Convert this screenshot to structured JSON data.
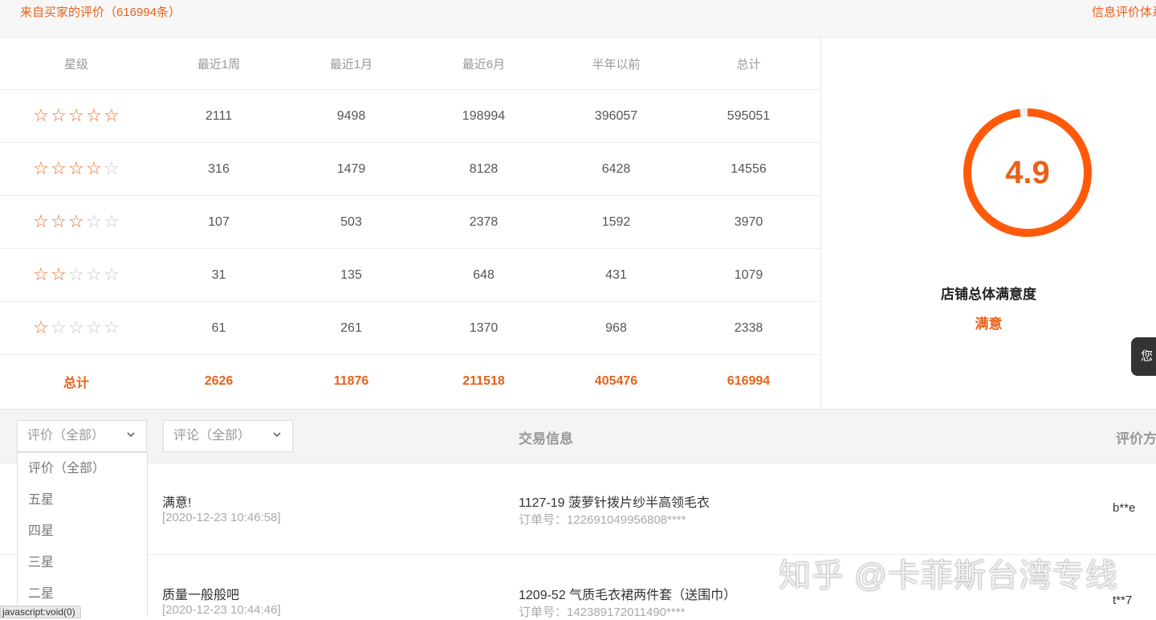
{
  "header": {
    "title": "来自买家的评价（616994条）",
    "right_link": "信息评价体系"
  },
  "stats": {
    "headers": [
      "星级",
      "最近1周",
      "最近1月",
      "最近6月",
      "半年以前",
      "总计"
    ],
    "rows": [
      {
        "stars": 5,
        "values": [
          "2111",
          "9498",
          "198994",
          "396057",
          "595051"
        ]
      },
      {
        "stars": 4,
        "values": [
          "316",
          "1479",
          "8128",
          "6428",
          "14556"
        ]
      },
      {
        "stars": 3,
        "values": [
          "107",
          "503",
          "2378",
          "1592",
          "3970"
        ]
      },
      {
        "stars": 2,
        "values": [
          "31",
          "135",
          "648",
          "431",
          "1079"
        ]
      },
      {
        "stars": 1,
        "values": [
          "61",
          "261",
          "1370",
          "968",
          "2338"
        ]
      }
    ],
    "total": {
      "label": "总计",
      "values": [
        "2626",
        "11876",
        "211518",
        "405476",
        "616994"
      ]
    }
  },
  "score": {
    "value": "4.9",
    "ring_fraction": 0.98,
    "title": "店铺总体满意度",
    "level": "满意"
  },
  "side_tip": "您",
  "filters": {
    "rating_select": "评价（全部）",
    "comment_select": "评论（全部）",
    "col_trade": "交易信息",
    "col_right": "评价方"
  },
  "dropdown": {
    "options": [
      "评价（全部）",
      "五星",
      "四星",
      "三星",
      "二星"
    ]
  },
  "reviews": [
    {
      "comment": "满意!",
      "time": "[2020-12-23 10:46:58]",
      "product": "1127-19 菠萝针拨片纱半高领毛衣",
      "order": "订单号：122691049956808****",
      "user": "b**e"
    },
    {
      "comment": "质量一般般吧",
      "time": "[2020-12-23 10:44:46]",
      "product": "1209-52 气质毛衣裙两件套（送围巾）",
      "order": "订单号：142389172011490****",
      "user": "t**7"
    }
  ],
  "status_bar": "javascript:void(0)",
  "watermark": "知乎 @卡菲斯台湾专线",
  "colors": {
    "accent": "#e8611a",
    "ring": "#ff5a0a",
    "star_on": "#ef6b24",
    "star_off": "#c7c7c7"
  }
}
